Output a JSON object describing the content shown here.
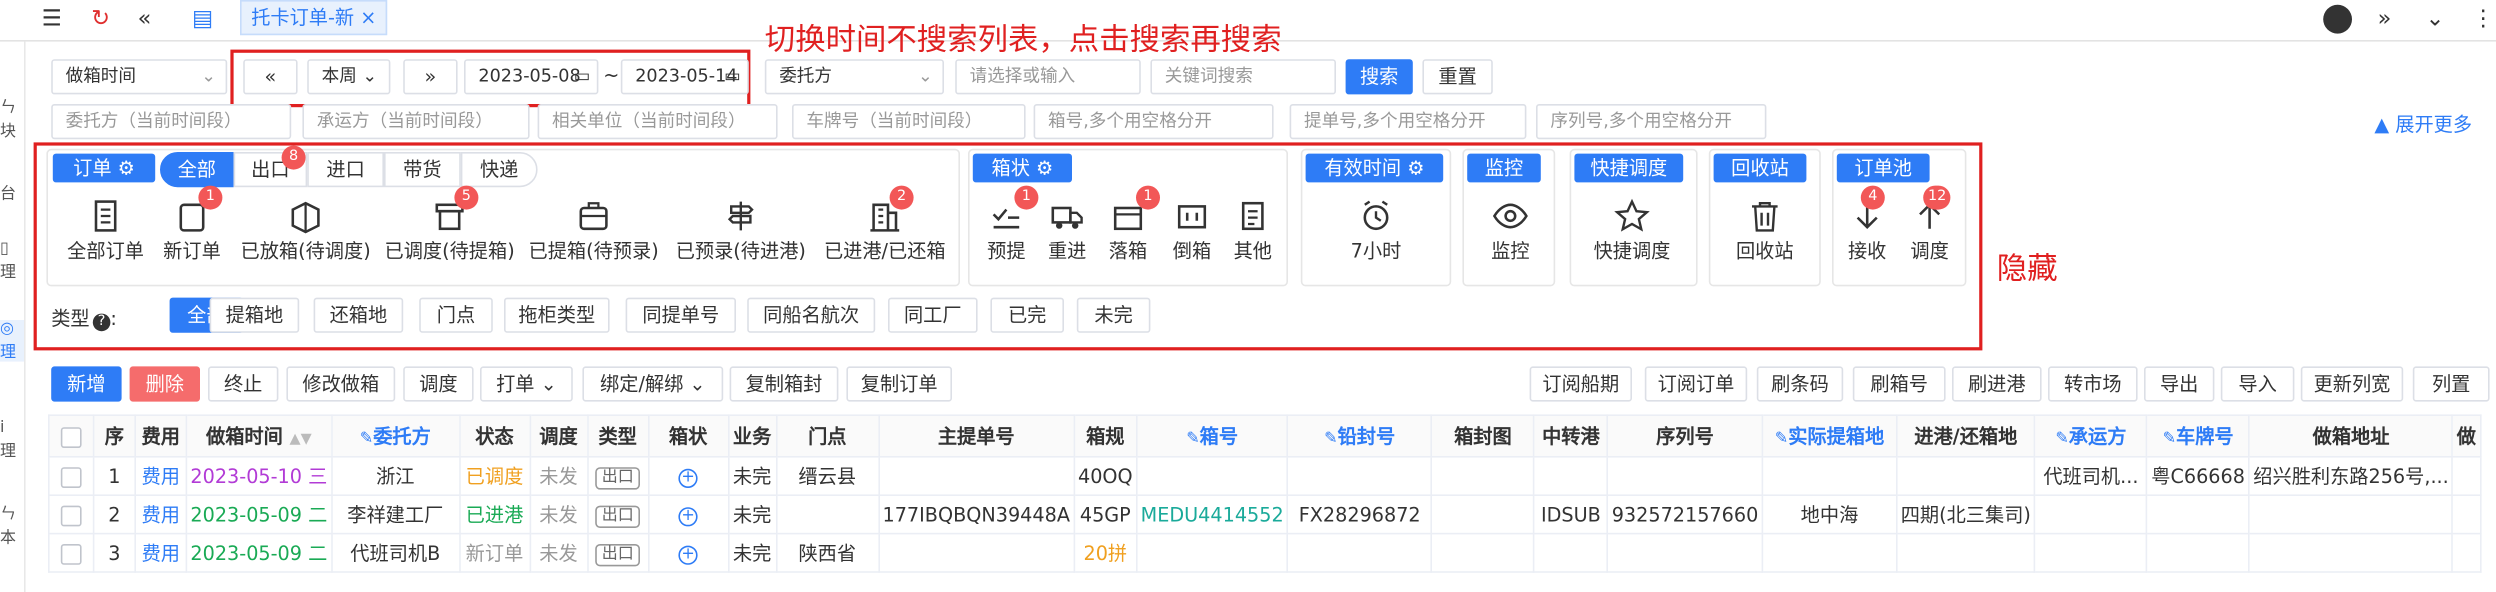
{
  "tabs": {
    "active": "托卡订单-新"
  },
  "annotations": {
    "top": "切换时间不搜索列表，点击搜索再搜索",
    "right": "隐藏"
  },
  "filters": {
    "time_field": "做箱时间",
    "period": "本周",
    "date_start": "2023-05-08",
    "date_end": "2023-05-14",
    "date_sep": "~",
    "consignor": "委托方",
    "placeholder_select": "请选择或输入",
    "placeholder_keyword": "关键词搜索",
    "search": "搜索",
    "reset": "重置",
    "row2": [
      "委托方（当前时间段）",
      "承运方（当前时间段）",
      "相关单位（当前时间段）",
      "车牌号（当前时间段）",
      "箱号,多个用空格分开",
      "提单号,多个用空格分开",
      "序列号,多个用空格分开"
    ],
    "expand": "展开更多"
  },
  "orders": {
    "title": "订单",
    "segments": [
      "全部",
      "出口",
      "进口",
      "带货",
      "快递"
    ],
    "segment_badges": {
      "出口": "8"
    },
    "items": [
      {
        "label": "全部订单",
        "icon": "list-doc-icon"
      },
      {
        "label": "新订单",
        "icon": "new-doc-icon",
        "badge": "1"
      },
      {
        "label": "已放箱(待调度)",
        "icon": "box-open-icon"
      },
      {
        "label": "已调度(待提箱)",
        "icon": "dispatch-icon",
        "badge": "5"
      },
      {
        "label": "已提箱(待预录)",
        "icon": "briefcase-icon"
      },
      {
        "label": "已预录(待进港)",
        "icon": "signpost-icon"
      },
      {
        "label": "已进港/已还箱",
        "icon": "building-icon",
        "badge": "2"
      }
    ]
  },
  "box_status": {
    "title": "箱状",
    "items": [
      {
        "label": "预提",
        "icon": "checklist-icon",
        "badge": "1"
      },
      {
        "label": "重进",
        "icon": "truck-icon"
      },
      {
        "label": "落箱",
        "icon": "container-icon",
        "badge": "1"
      },
      {
        "label": "倒箱",
        "icon": "swap-box-icon"
      },
      {
        "label": "其他",
        "icon": "doc-lines-icon"
      }
    ]
  },
  "valid_time": {
    "title": "有效时间",
    "label": "7小时"
  },
  "monitor": {
    "title": "监控",
    "label": "监控"
  },
  "quick_dispatch": {
    "title": "快捷调度",
    "label": "快捷调度"
  },
  "recycle": {
    "title": "回收站",
    "label": "回收站"
  },
  "order_pool": {
    "title": "订单池",
    "items": [
      {
        "label": "接收",
        "badge": "4"
      },
      {
        "label": "调度",
        "badge": "12"
      }
    ]
  },
  "types": {
    "label": "类型",
    "chips": [
      "全部",
      "提箱地",
      "还箱地",
      "门点",
      "拖柜类型",
      "同提单号",
      "同船名航次",
      "同工厂",
      "已完",
      "未完"
    ]
  },
  "toolbar_left": [
    "新增",
    "删除",
    "终止",
    "修改做箱",
    "调度",
    "打单",
    "绑定/解绑",
    "复制箱封",
    "复制订单"
  ],
  "toolbar_right": [
    "订阅船期",
    "订阅订单",
    "刷条码",
    "刷箱号",
    "刷进港",
    "转市场",
    "导出",
    "导入",
    "更新列宽",
    "列置"
  ],
  "table": {
    "columns": [
      "序",
      "费用",
      "做箱时间",
      "委托方",
      "状态",
      "调度",
      "类型",
      "箱状",
      "业务",
      "门点",
      "主提单号",
      "箱规",
      "箱号",
      "铅封号",
      "箱封图",
      "中转港",
      "序列号",
      "实际提箱地",
      "进港/还箱地",
      "承运方",
      "车牌号",
      "做箱地址",
      "做"
    ],
    "rows": [
      {
        "seq": "1",
        "fee": "费用",
        "time": "2023-05-10 三",
        "client": "浙江",
        "status": "已调度",
        "dispatch": "未发",
        "type": "出口",
        "business": "未完",
        "door": "缙云县",
        "bill": "",
        "spec": "40OQ",
        "box": "",
        "seal": "",
        "sealimg": "",
        "transit": "",
        "serial": "",
        "pickup": "",
        "return": "",
        "carrier": "代班司机...",
        "plate": "粤C66668",
        "addr": "绍兴胜利东路256号,..."
      },
      {
        "seq": "2",
        "fee": "费用",
        "time": "2023-05-09 二",
        "client": "李祥建工厂",
        "status": "已进港",
        "dispatch": "未发",
        "type": "出口",
        "business": "未完",
        "door": "",
        "bill": "177IBQBQN39448A",
        "spec": "45GP",
        "box": "MEDU4414552",
        "seal": "FX28296872",
        "sealimg": "",
        "transit": "IDSUB",
        "serial": "932572157660",
        "pickup": "地中海",
        "return": "四期(北三集司)",
        "carrier": "",
        "plate": "",
        "addr": ""
      },
      {
        "seq": "3",
        "fee": "费用",
        "time": "2023-05-09 二",
        "client": "代班司机B",
        "status": "新订单",
        "dispatch": "未发",
        "type": "出口",
        "business": "未完",
        "door": "陕西省",
        "bill": "",
        "spec": "20拼",
        "box": "",
        "seal": "",
        "sealimg": "",
        "transit": "",
        "serial": "",
        "pickup": "",
        "return": "",
        "carrier": "",
        "plate": "",
        "addr": ""
      }
    ]
  },
  "colors": {
    "primary": "#2e7cf6",
    "danger": "#f56c6c",
    "annotation": "#e02020",
    "status_dispatched": "#f0a020",
    "status_port": "#1aaa55",
    "time_purple": "#b23bd6",
    "time_green": "#1aaa55"
  }
}
